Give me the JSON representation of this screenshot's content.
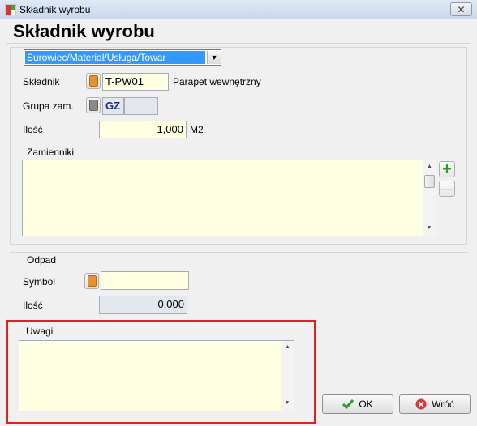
{
  "window": {
    "title": "Składnik wyrobu"
  },
  "header": {
    "title": "Składnik wyrobu"
  },
  "type_select": {
    "value": "Surowiec/Materiał/Usługa/Towar"
  },
  "skladnik": {
    "label": "Składnik",
    "code": "T-PW01",
    "name": "Parapet wewnętrzny"
  },
  "grupa": {
    "label": "Grupa zam.",
    "code": "GZ",
    "value": ""
  },
  "ilosc": {
    "label": "Ilość",
    "value": "1,000",
    "unit": "M2"
  },
  "zamienniki": {
    "label": "Zamienniki",
    "add_label": "+",
    "remove_label": "—"
  },
  "odpad": {
    "label": "Odpad",
    "symbol_label": "Symbol",
    "symbol_value": "",
    "ilosc_label": "Ilość",
    "ilosc_value": "0,000"
  },
  "uwagi": {
    "label": "Uwagi",
    "value": ""
  },
  "buttons": {
    "ok": "OK",
    "cancel": "Wróć"
  },
  "colors": {
    "accent": "#3399ff",
    "field_bg": "#ffffe1",
    "highlight": "#e02020",
    "add": "#2e9a2e"
  }
}
